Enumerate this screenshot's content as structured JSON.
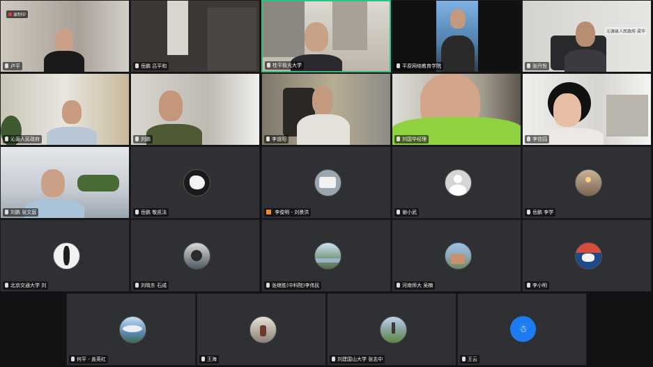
{
  "recording": {
    "label": "录制中"
  },
  "row1": [
    {
      "name": "卢平",
      "scene": "home"
    },
    {
      "name": "岳鹏 吕平和",
      "scene": "window"
    },
    {
      "name": "桂平极光大学",
      "scene": "shelf"
    },
    {
      "name": "平原网络教育学院",
      "scene": "sky"
    },
    {
      "name": "张丹哲",
      "scene": "office",
      "sign": "沁源县人民政府 梁华"
    }
  ],
  "row2": [
    {
      "name": "沁源人民政府",
      "scene": "room"
    },
    {
      "name": "刘鹏",
      "scene": "headset"
    },
    {
      "name": "李道阳",
      "scene": "leather"
    },
    {
      "name": "刘国华经理",
      "scene": "green"
    },
    {
      "name": "李佳园",
      "scene": "woman"
    }
  ],
  "row3": [
    {
      "name": "刘鹏 张文庭",
      "scene": "officeRow",
      "video": true
    },
    {
      "name": "岳鹏 敬凯法",
      "avatar_color": "#e9e3d8",
      "video": false
    },
    {
      "name": "李俊明 - 刘景洪",
      "avatar_color": "#9aa6b1",
      "video": false,
      "badge": true
    },
    {
      "name": "谢小武",
      "avatar_color": "#d5d5d5",
      "video": false
    },
    {
      "name": "岳鹏 李学",
      "avatar_color": "#7d6450",
      "video": false
    }
  ],
  "row4": [
    {
      "name": "北京交通大学 刘",
      "avatar_color": "#f1f1f1"
    },
    {
      "name": "刘晓东 石成",
      "avatar_color": "#4f5a62"
    },
    {
      "name": "张继胜(中科院)李伟民",
      "avatar_color": "#7b9a84"
    },
    {
      "name": "河南师大 吴楠",
      "avatar_color": "#8fa7b8"
    },
    {
      "name": "李小明",
      "avatar_color": "#1c4a8a"
    }
  ],
  "row5": [
    {
      "name": "何平 - 盖英红",
      "avatar_color": "#5d8ab8"
    },
    {
      "name": "王海",
      "avatar_color": "#8c8277"
    },
    {
      "name": "刘建国山大学 张志中",
      "avatar_color": "#88a3a0"
    },
    {
      "name": "王云",
      "avatar_color": "#1e7cf2",
      "initial_icon": "☃"
    }
  ]
}
